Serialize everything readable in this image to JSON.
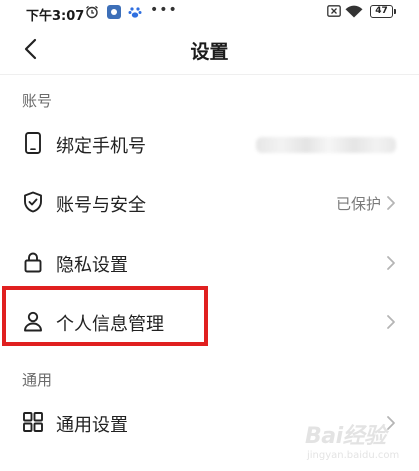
{
  "status_bar": {
    "time": "下午3:07",
    "battery": "47",
    "icons": [
      "alarm-icon",
      "app-badge-icon",
      "paw-icon",
      "more-dots-icon",
      "mute-icon",
      "wifi-icon",
      "battery-icon"
    ]
  },
  "nav": {
    "title": "设置",
    "back_icon": "chevron-left-icon"
  },
  "sections": {
    "account": {
      "header": "账号",
      "items": [
        {
          "label": "绑定手机号",
          "value": "",
          "icon": "phone-icon"
        },
        {
          "label": "账号与安全",
          "value": "已保护",
          "icon": "shield-check-icon"
        },
        {
          "label": "隐私设置",
          "value": "",
          "icon": "lock-icon"
        },
        {
          "label": "个人信息管理",
          "value": "",
          "icon": "person-icon"
        }
      ]
    },
    "general": {
      "header": "通用",
      "items": [
        {
          "label": "通用设置",
          "value": "",
          "icon": "grid-icon"
        }
      ]
    }
  },
  "highlight_color": "#e02020",
  "watermark": {
    "text": "Bai经验",
    "sub": "jingyan.baidu.com"
  }
}
